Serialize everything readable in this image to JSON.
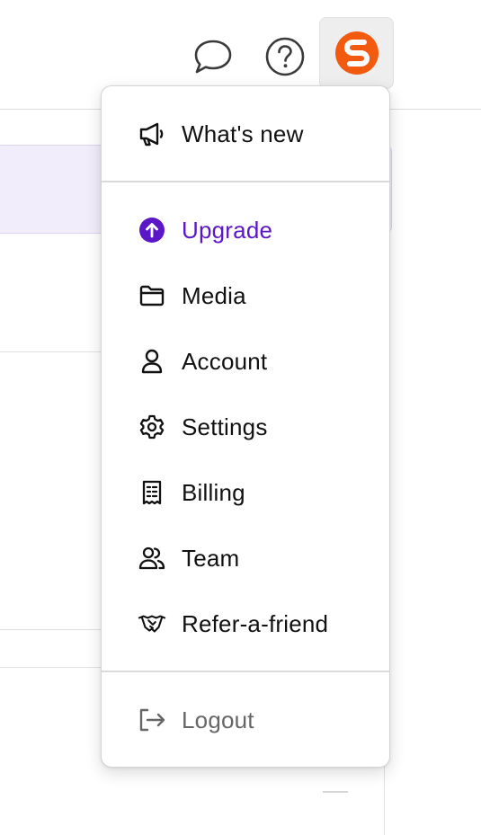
{
  "header": {
    "chat_icon": "chat-bubble-icon",
    "help_icon": "help-circle-icon",
    "avatar_icon": "brand-logo-icon"
  },
  "menu": {
    "whats_new": {
      "label": "What's new",
      "icon": "megaphone-icon"
    },
    "upgrade": {
      "label": "Upgrade",
      "icon": "arrow-up-circle-icon"
    },
    "media": {
      "label": "Media",
      "icon": "folder-icon"
    },
    "account": {
      "label": "Account",
      "icon": "user-icon"
    },
    "settings": {
      "label": "Settings",
      "icon": "gear-icon"
    },
    "billing": {
      "label": "Billing",
      "icon": "receipt-icon"
    },
    "team": {
      "label": "Team",
      "icon": "users-icon"
    },
    "refer": {
      "label": "Refer-a-friend",
      "icon": "handshake-icon"
    },
    "logout": {
      "label": "Logout",
      "icon": "logout-icon"
    }
  },
  "colors": {
    "accent": "#5b16c7",
    "text": "#111111",
    "muted": "#666666",
    "brand": "#f25a0f"
  }
}
